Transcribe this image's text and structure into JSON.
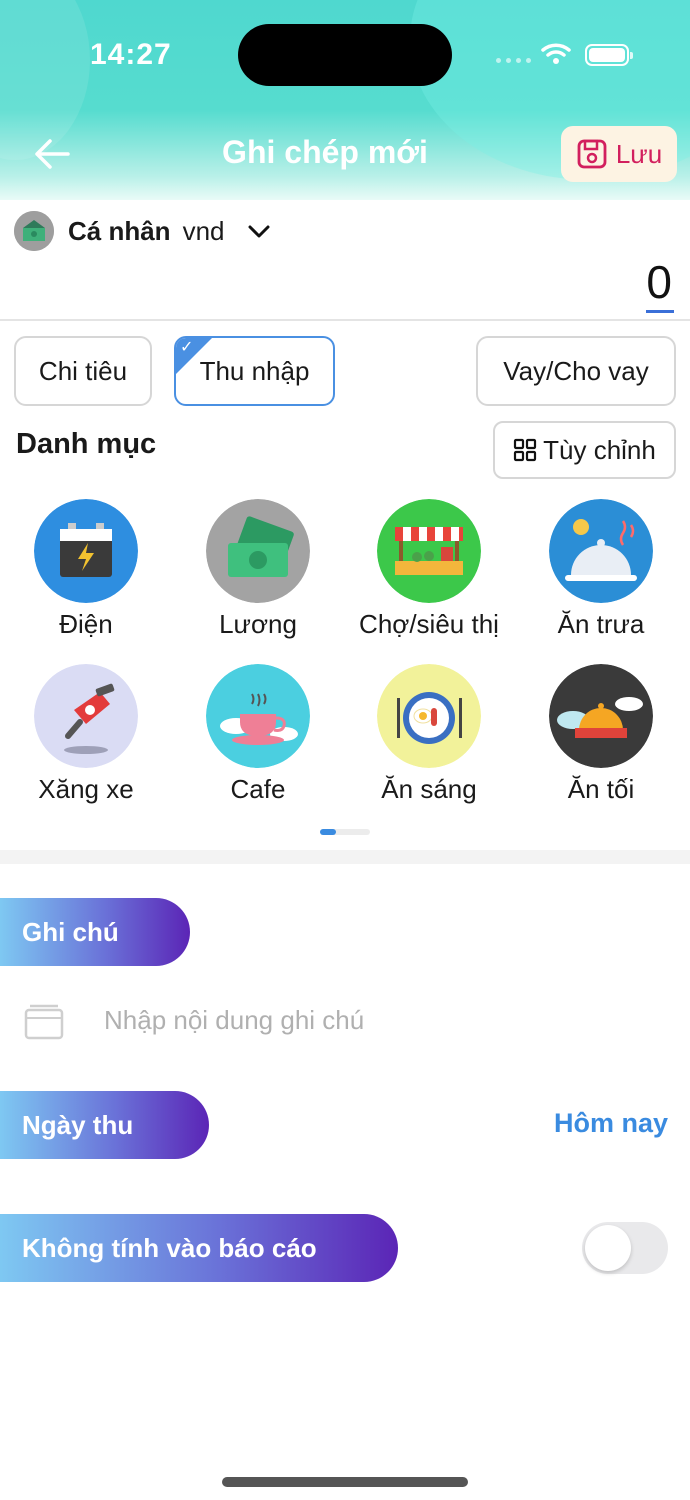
{
  "status_bar": {
    "time": "14:27"
  },
  "header": {
    "title": "Ghi chép mới",
    "save_label": "Lưu"
  },
  "account": {
    "name": "Cá nhân",
    "currency": "vnd"
  },
  "amount": "0",
  "tabs": [
    {
      "label": "Chi tiêu",
      "active": false
    },
    {
      "label": "Thu nhập",
      "active": true
    },
    {
      "label": "Vay/Cho vay",
      "active": false
    }
  ],
  "categories_section": {
    "title": "Danh mục",
    "customize_label": "Tùy chỉnh",
    "items": [
      {
        "label": "Điện",
        "icon": "battery-icon",
        "bg": "#2e8ee0"
      },
      {
        "label": "Lương",
        "icon": "money-icon",
        "bg": "#a3a3a3"
      },
      {
        "label": "Chợ/siêu thị",
        "icon": "market-stall-icon",
        "bg": "#3cc84a"
      },
      {
        "label": "Ăn trưa",
        "icon": "cloche-icon",
        "bg": "#2b8ed6"
      },
      {
        "label": "Xăng xe",
        "icon": "fuel-nozzle-icon",
        "bg": "#dadcf4"
      },
      {
        "label": "Cafe",
        "icon": "coffee-cup-icon",
        "bg": "#4bcfe0"
      },
      {
        "label": "Ăn sáng",
        "icon": "breakfast-plate-icon",
        "bg": "#f2f29a"
      },
      {
        "label": "Ăn tối",
        "icon": "dinner-cloche-icon",
        "bg": "#3a3a3a"
      }
    ],
    "page_index": 1,
    "page_count": 2
  },
  "note": {
    "title": "Ghi chú",
    "placeholder": "Nhập nội dung ghi chú",
    "value": ""
  },
  "date": {
    "title": "Ngày thu",
    "value": "Hôm nay"
  },
  "exclude_report": {
    "title": "Không tính vào báo cáo",
    "enabled": false
  },
  "colors": {
    "accent": "#3a8be0",
    "save": "#d21f5e",
    "header": "#4fd8cf"
  }
}
